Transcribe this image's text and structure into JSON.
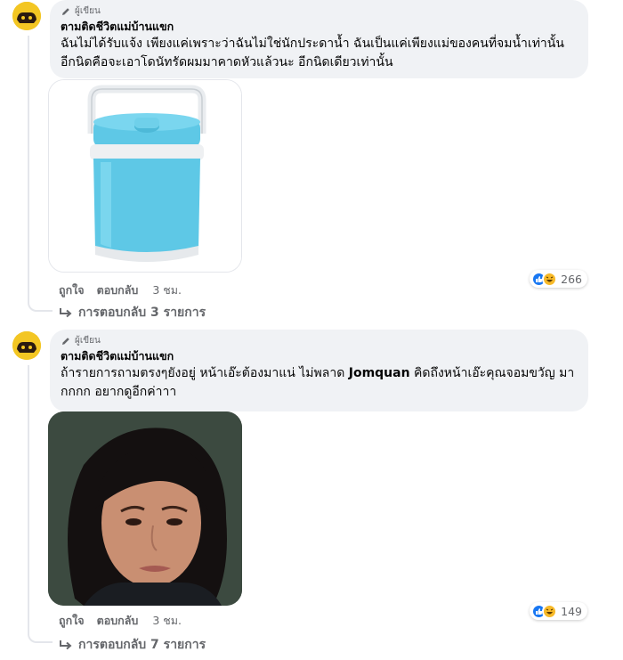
{
  "comments": [
    {
      "badge": "ผู้เขียน",
      "author": "ตามติดชีวิตแม่บ้านแขก",
      "text": "ฉันไม่ได้รับแจ้ง เพียงแค่เพราะว่าฉันไม่ใช่นักประดาน้ำ ฉันเป็นแค่เพียงแม่ของคนที่จมน้ำเท่านั้น อีกนิดคือจะเอาโดนัทรัดผมมาคาดหัวแล้วนะ อีกนิดเดียวเท่านั้น",
      "attachment": "blue-cooler-jug-image",
      "like_label": "ถูกใจ",
      "reply_label": "ตอบกลับ",
      "time": "3 ชม.",
      "reaction_count": "266",
      "replies_label": "การตอบกลับ 3 รายการ"
    },
    {
      "badge": "ผู้เขียน",
      "author": "ตามติดชีวิตแม่บ้านแขก",
      "text_before": "ถ้ารายการถามตรงๆยังอยู่ หน้าเอ๊ะต้องมาแน่ ไม่พลาด ",
      "mention": "Jomquan",
      "text_after": " คิดถึงหน้าเอ๊ะคุณจอมขวัญ มากกกก อยากดูอีกค่าาา",
      "attachment": "woman-portrait-image",
      "like_label": "ถูกใจ",
      "reply_label": "ตอบกลับ",
      "time": "3 ชม.",
      "reaction_count": "149",
      "replies_label": "การตอบกลับ 7 รายการ"
    }
  ],
  "icons": {
    "pen": "pencil-icon",
    "like": "like-reaction-icon",
    "haha": "haha-reaction-icon",
    "reply_arrow": "reply-arrow-icon"
  },
  "colors": {
    "bubble": "#f0f2f5",
    "meta": "#65676b",
    "like_blue": "#1877f2",
    "haha_yellow": "#f7b928",
    "cooler_blue": "#5ec8e6"
  }
}
